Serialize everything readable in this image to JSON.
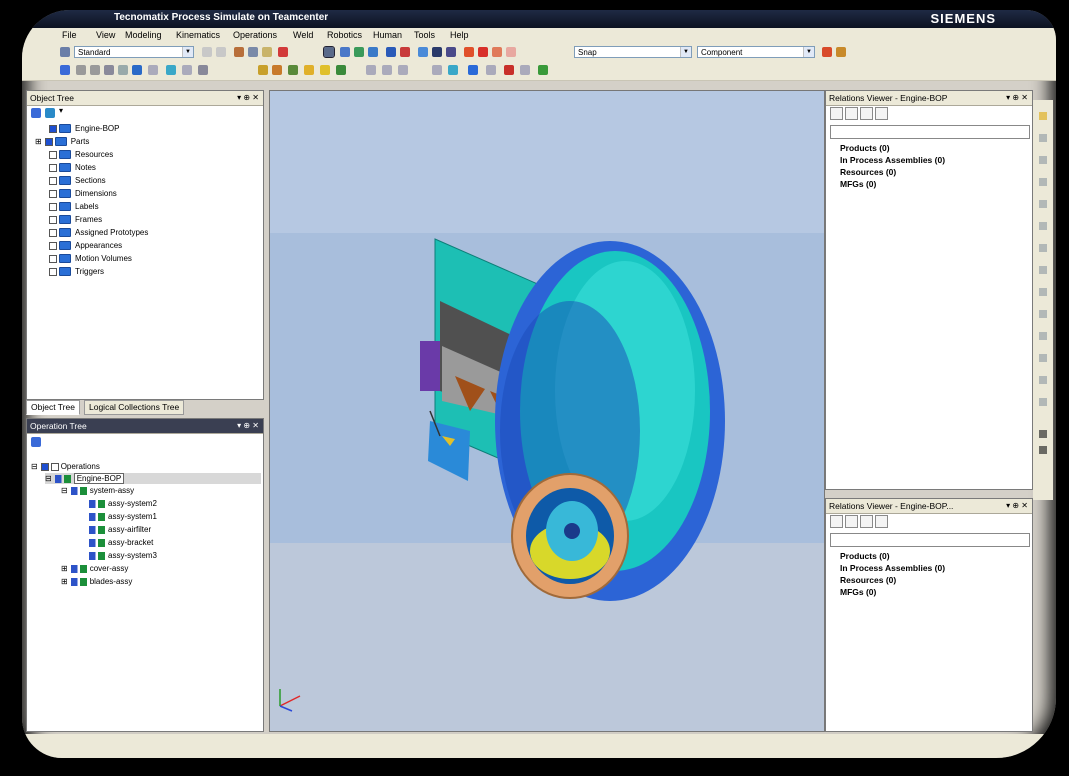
{
  "window": {
    "title": "Tecnomatix Process Simulate on Teamcenter",
    "brand": "SIEMENS"
  },
  "menu": [
    {
      "label": "File"
    },
    {
      "label": "View"
    },
    {
      "label": "Modeling"
    },
    {
      "label": "Kinematics"
    },
    {
      "label": "Operations"
    },
    {
      "label": "Weld"
    },
    {
      "label": "Robotics"
    },
    {
      "label": "Human"
    },
    {
      "label": "Tools"
    },
    {
      "label": "Help"
    }
  ],
  "toolbar": {
    "layout_select": "Standard",
    "snap_select": "Snap",
    "pick_level_select": "Component"
  },
  "object_tree": {
    "header": "Object Tree",
    "items": [
      "Engine-BOP",
      "Parts",
      "Resources",
      "Notes",
      "Sections",
      "Dimensions",
      "Labels",
      "Frames",
      "Assigned Prototypes",
      "Appearances",
      "Motion Volumes",
      "Triggers"
    ],
    "tabs": [
      "Object Tree",
      "Logical Collections Tree"
    ]
  },
  "operation_tree": {
    "header": "Operation Tree",
    "root": "Operations",
    "bop": "Engine-BOP",
    "system_group": "system-assy",
    "children": [
      "assy-system2",
      "assy-system1",
      "assy-airfilter",
      "assy-bracket",
      "assy-system3"
    ],
    "siblings": [
      "cover-assy",
      "blades-assy"
    ]
  },
  "relations_top": {
    "header": "Relations Viewer - Engine-BOP",
    "rows": [
      "Products (0)",
      "In Process Assemblies (0)",
      "Resources (0)",
      "MFGs (0)"
    ]
  },
  "relations_bottom": {
    "header": "Relations Viewer - Engine-BOP...",
    "rows": [
      "Products (0)",
      "In Process Assemblies (0)",
      "Resources (0)",
      "MFGs (0)"
    ]
  },
  "colors": {
    "viewport_bg": "#bdc9dc",
    "engine_blue": "#2c64d6",
    "engine_cyan": "#19c6c2",
    "intake_ring": "#e2a06a",
    "panel_teal": "#1dbfb4"
  }
}
